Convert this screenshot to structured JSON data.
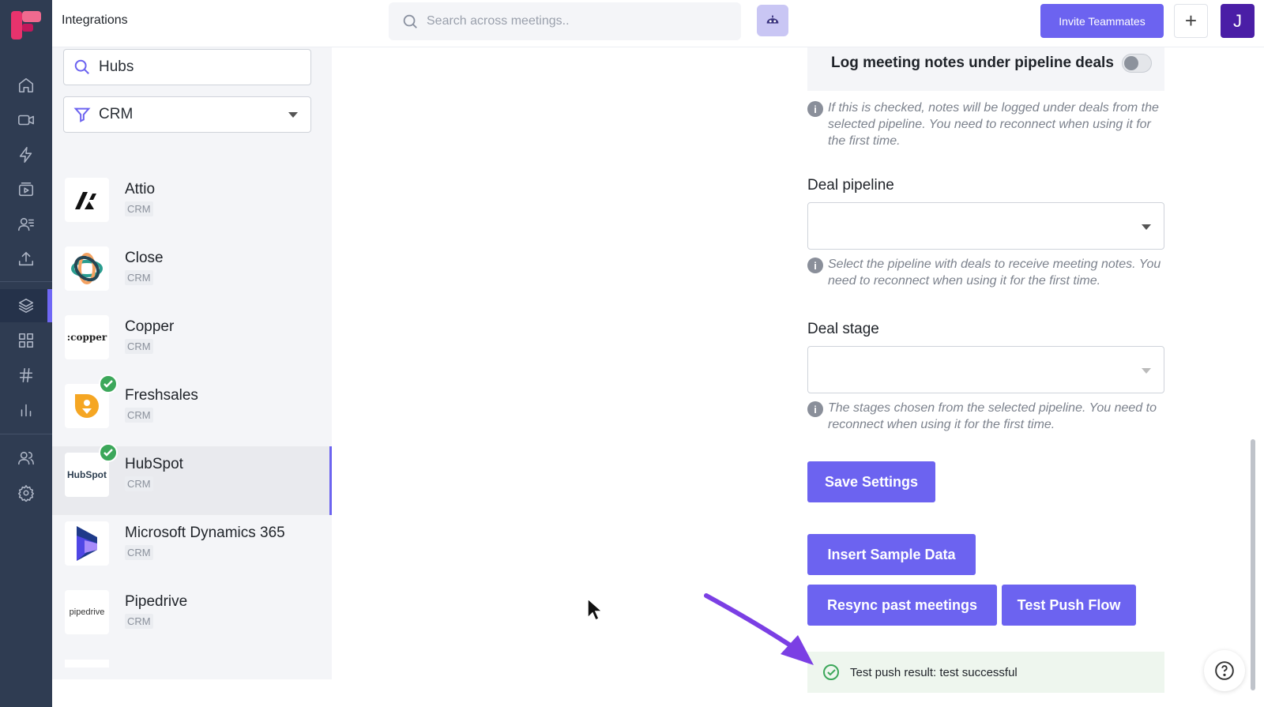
{
  "header": {
    "title": "Integrations",
    "search_placeholder": "Search across meetings..",
    "invite_label": "Invite Teammates",
    "plus_label": "+",
    "avatar_initial": "J"
  },
  "sidebar": {
    "icons": [
      "home-icon",
      "video-icon",
      "bolt-icon",
      "slides-icon",
      "contacts-icon",
      "upload-icon",
      "layers-icon",
      "grid-icon",
      "hash-icon",
      "chart-icon",
      "team-icon",
      "gear-icon"
    ],
    "active": "layers-icon"
  },
  "filters": {
    "search_value": "Hubs",
    "category_value": "CRM"
  },
  "integrations": [
    {
      "name": "Attio",
      "tag": "CRM",
      "connected": false
    },
    {
      "name": "Close",
      "tag": "CRM",
      "connected": false
    },
    {
      "name": "Copper",
      "tag": "CRM",
      "connected": false,
      "logo_text": ":copper"
    },
    {
      "name": "Freshsales",
      "tag": "CRM",
      "connected": true
    },
    {
      "name": "HubSpot",
      "tag": "CRM",
      "connected": true,
      "selected": true,
      "logo_text": "HubSpot"
    },
    {
      "name": "Microsoft Dynamics 365",
      "tag": "CRM",
      "connected": false
    },
    {
      "name": "Pipedrive",
      "tag": "CRM",
      "connected": false,
      "logo_text": "pipedrive"
    }
  ],
  "settings": {
    "log_notes_label": "Log meeting notes under pipeline deals",
    "log_notes_enabled": false,
    "log_notes_hint": "If this is checked, notes will be logged under deals from the selected pipeline. You need to reconnect when using it for the first time.",
    "deal_pipeline_label": "Deal pipeline",
    "deal_pipeline_value": "",
    "deal_pipeline_hint": "Select the pipeline with deals to receive meeting notes. You need to reconnect when using it for the first time.",
    "deal_stage_label": "Deal stage",
    "deal_stage_value": "",
    "deal_stage_hint": "The stages chosen from the selected pipeline. You need to reconnect when using it for the first time.",
    "save_label": "Save Settings",
    "insert_sample_label": "Insert Sample Data",
    "resync_label": "Resync past meetings",
    "test_push_label": "Test Push Flow",
    "result_text": "Test push result: test successful"
  },
  "colors": {
    "accent": "#6c63f0",
    "sidebar_bg": "#2f3c52",
    "success": "#3ca75a"
  }
}
